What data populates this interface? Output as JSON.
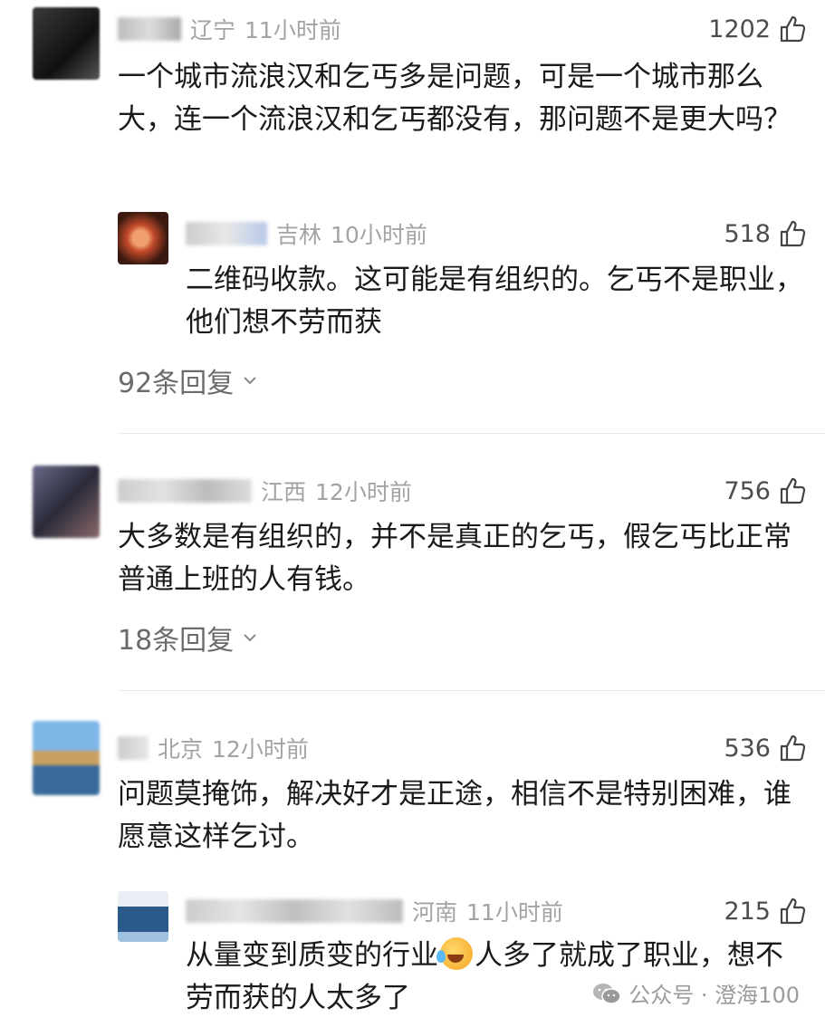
{
  "comments": [
    {
      "location": "辽宁",
      "time": "11小时前",
      "likes": "1202",
      "text": "一个城市流浪汉和乞丐多是问题，可是一个城市那么大，连一个流浪汉和乞丐都没有，那问题不是更大吗？",
      "reply": {
        "location": "吉林",
        "time": "10小时前",
        "likes": "518",
        "text": "二维码收款。这可能是有组织的。乞丐不是职业，他们想不劳而获"
      },
      "replies_label": "92条回复"
    },
    {
      "location": "江西",
      "time": "12小时前",
      "likes": "756",
      "text": "大多数是有组织的，并不是真正的乞丐，假乞丐比正常普通上班的人有钱。",
      "replies_label": "18条回复"
    },
    {
      "location": "北京",
      "time": "12小时前",
      "likes": "536",
      "text": "问题莫掩饰，解决好才是正途，相信不是特别困难，谁愿意这样乞讨。",
      "reply": {
        "location": "河南",
        "time": "11小时前",
        "likes": "215",
        "text_part1": "从量变到质变的行业",
        "text_part2": "人多了就成了职业，想不劳而获的人太多了"
      }
    }
  ],
  "watermark": {
    "label": "公众号 · 澄海100"
  },
  "icons": {
    "like": "thumbs-up-icon",
    "chevron": "chevron-down-icon",
    "emoji": "crying-laughing-emoji",
    "wechat": "wechat-icon"
  }
}
